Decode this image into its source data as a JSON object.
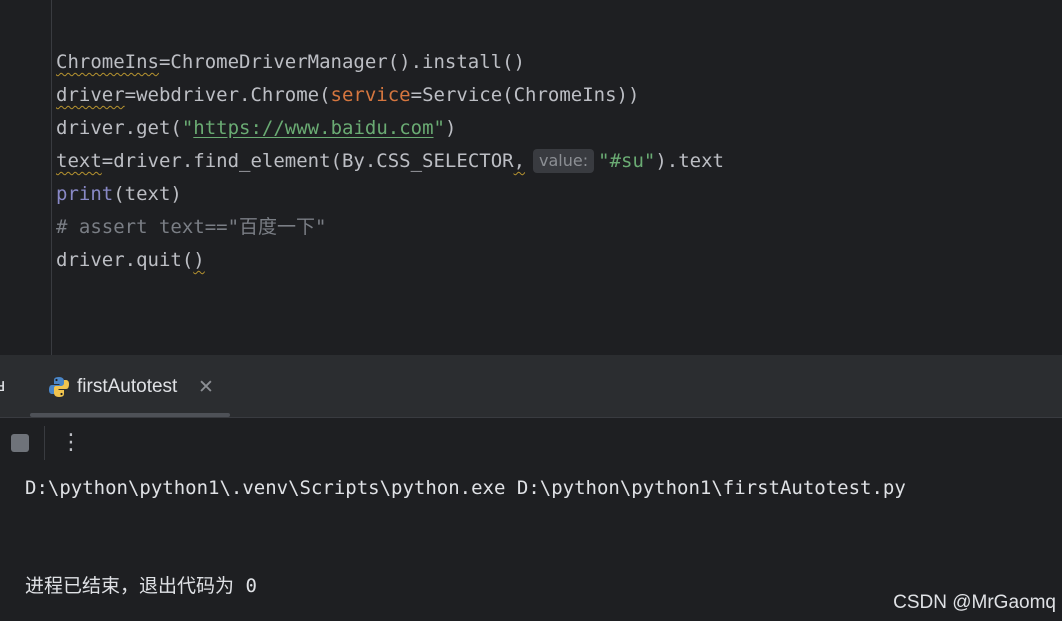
{
  "editor": {
    "lines": {
      "line1": {
        "a": "ChromeIns",
        "b": "=ChromeDriverManager().install()"
      },
      "line2": {
        "a": "driver",
        "b": "=webdriver.Chrome(",
        "param": "service",
        "c": "=Service(ChromeIns))"
      },
      "line3": {
        "a": "driver.get(",
        "q1": "\"",
        "url": "https://www.baidu.com",
        "q2": "\"",
        "b": ")"
      },
      "line4": {
        "a": "text",
        "b": "=driver.find_element(By.CSS_SELECTOR",
        "comma": ",",
        "hint": "value:",
        "str": "\"#su\"",
        "c": ").text"
      },
      "line5": {
        "kw": "print",
        "b": "(text)"
      },
      "line6": {
        "comment": "# assert text==\"百度一下\""
      },
      "line7": {
        "a": "driver.quit(",
        "b": ")"
      }
    }
  },
  "run_panel": {
    "edge_glyph": "ⅎ",
    "tab": {
      "label": "firstAutotest",
      "icon": "python-icon",
      "close": "✕"
    },
    "toolbar": {
      "stop_icon": "stop-icon",
      "more": "⋮"
    },
    "console": {
      "command": "D:\\python\\python1\\.venv\\Scripts\\python.exe D:\\python\\python1\\firstAutotest.py",
      "exit_message": "进程已结束，退出代码为 0"
    }
  },
  "watermark": "CSDN @MrGaomq",
  "colors": {
    "background": "#1e1f22",
    "keyword": "#c77dbb",
    "param": "#d5763f",
    "string": "#6aab73",
    "comment": "#7a7e85"
  }
}
